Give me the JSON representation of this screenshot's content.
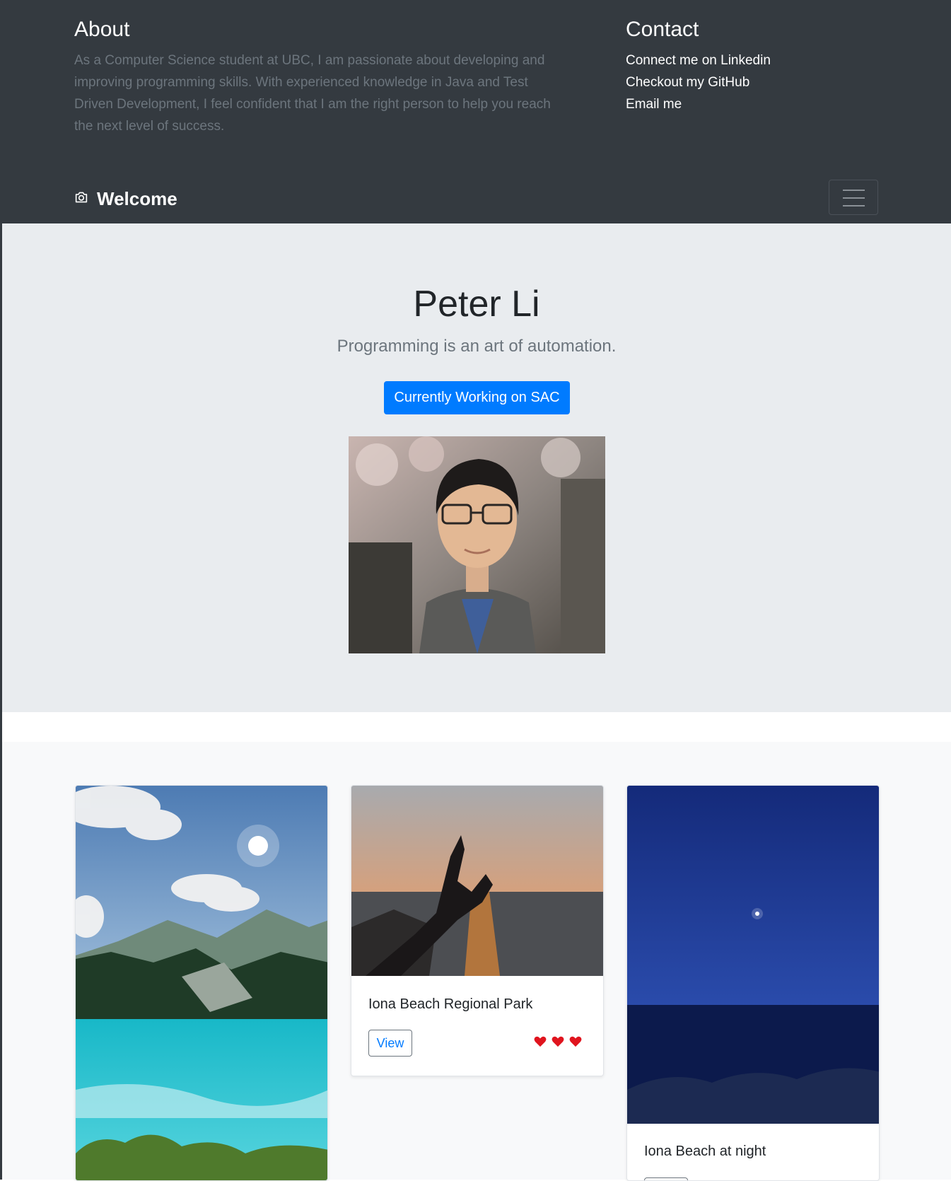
{
  "header": {
    "about_title": "About",
    "about_text": "As a Computer Science student at UBC, I am passionate about developing and improving programming skills. With experienced knowledge in Java and Test Driven Development, I feel confident that I am the right person to help you reach the next level of success.",
    "contact_title": "Contact",
    "contact_links": [
      "Connect me on Linkedin",
      "Checkout my GitHub",
      "Email me"
    ]
  },
  "navbar": {
    "brand_icon": "camera-icon",
    "brand_label": "Welcome",
    "toggler_icon": "hamburger-icon"
  },
  "hero": {
    "name": "Peter Li",
    "tagline": "Programming is an art of automation.",
    "button_label": "Currently Working on SAC"
  },
  "album": {
    "cards": [
      {
        "title": "",
        "image": "mountain-lake-photo"
      },
      {
        "title": "Iona Beach Regional Park",
        "button_label": "View",
        "hearts": 3,
        "image": "sunset-hand-photo"
      },
      {
        "title": "Iona Beach at night",
        "image": "night-sea-photo"
      }
    ]
  },
  "colors": {
    "header_bg": "#343a40",
    "jumbotron_bg": "#e9ecef",
    "primary": "#007bff",
    "album_bg": "#f8f9fa",
    "heart": "#e0141e"
  }
}
